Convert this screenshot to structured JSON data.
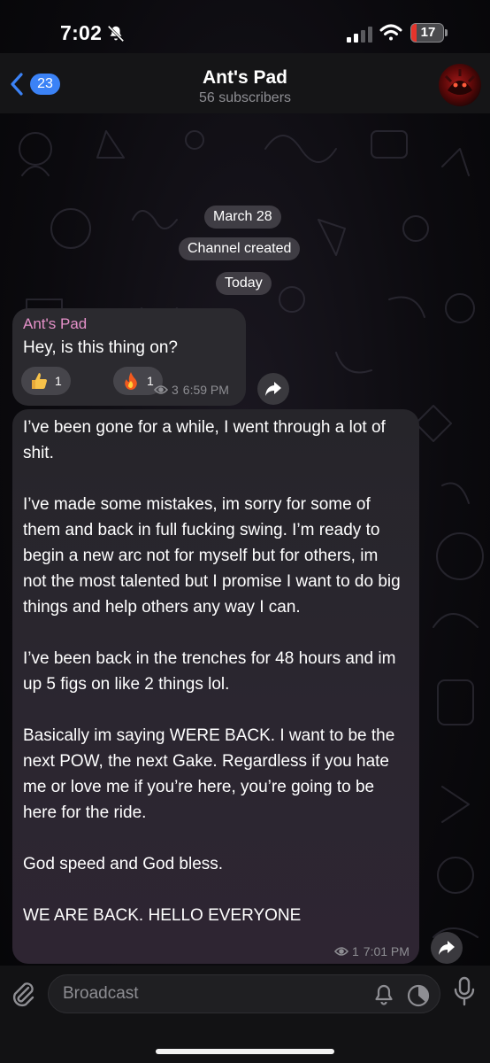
{
  "status_bar": {
    "time": "7:02",
    "battery_level": "17",
    "battery_fraction": 0.17,
    "icons": [
      "bell-slash-icon",
      "signal-icon",
      "wifi-icon",
      "battery-icon"
    ],
    "colors": {
      "battery_low": "#e5342b"
    }
  },
  "header": {
    "back_count": "23",
    "title": "Ant's Pad",
    "subtitle": "56 subscribers",
    "icons": [
      "back-chevron-icon",
      "channel-avatar"
    ],
    "colors": {
      "accent": "#3b82f6"
    }
  },
  "service": {
    "date_1": "March 28",
    "created": "Channel created",
    "date_2": "Today"
  },
  "messages": [
    {
      "author": "Ant's Pad",
      "text": "Hey, is this thing on?",
      "reactions": [
        {
          "emoji": "thumbs-up-icon",
          "count": "1"
        },
        {
          "emoji": "fire-icon",
          "count": "1"
        }
      ],
      "views": "3",
      "time": "6:59 PM",
      "author_color": "#e591c9"
    },
    {
      "paragraphs": [
        "I’ve been gone for a while, I went through a lot of shit.",
        "I’ve made some mistakes, im sorry for some of them and back in full fucking swing. I’m ready to begin a new arc not for myself but for others, im not the most talented but I promise I want to do big things and help others any way I can.",
        "I’ve been back in the trenches for 48 hours and im up 5 figs on like 2 things lol.",
        "Basically im saying WERE BACK. I want to be the next POW, the next Gake. Regardless if you hate me or love me if you’re here, you’re going to be here for the ride.",
        "God speed and God bless.",
        "WE ARE BACK. HELLO EVERYONE"
      ],
      "views": "1",
      "time": "7:01 PM"
    }
  ],
  "input": {
    "placeholder": "Broadcast",
    "icons": [
      "paperclip-icon",
      "bell-icon",
      "timer-icon",
      "microphone-icon"
    ]
  }
}
